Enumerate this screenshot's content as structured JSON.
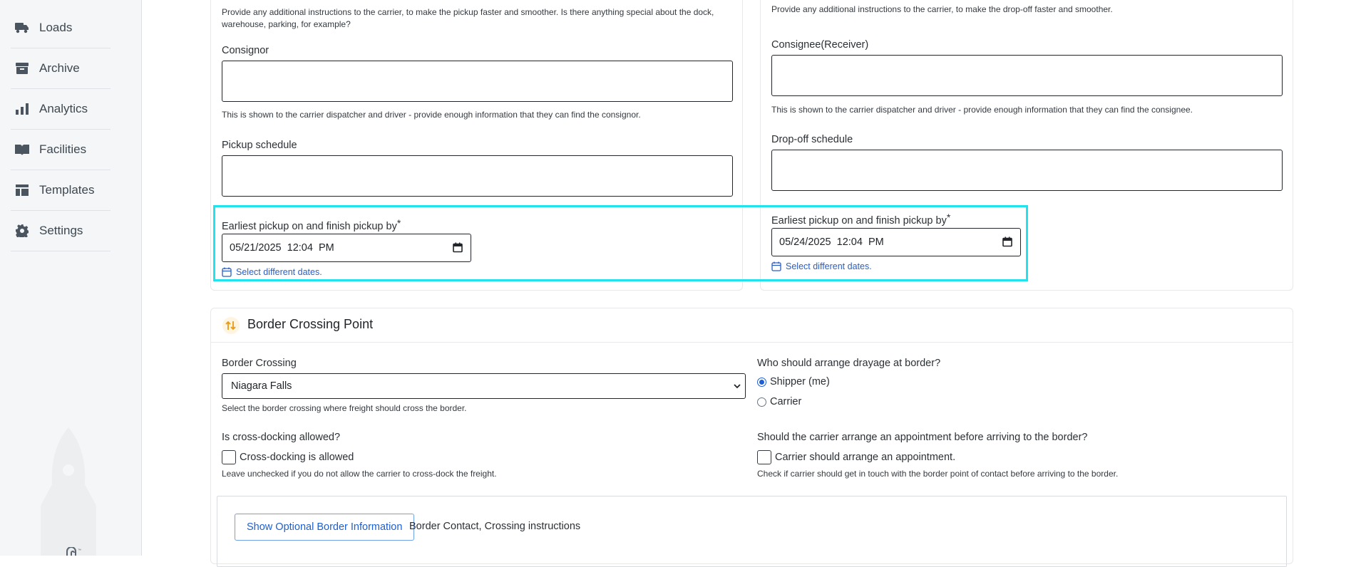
{
  "sidebar": {
    "items": [
      {
        "label": "Loads",
        "icon": "truck-icon"
      },
      {
        "label": "Archive",
        "icon": "archive-box-icon"
      },
      {
        "label": "Analytics",
        "icon": "bar-chart-icon"
      },
      {
        "label": "Facilities",
        "icon": "book-icon"
      },
      {
        "label": "Templates",
        "icon": "template-layout-icon"
      },
      {
        "label": "Settings",
        "icon": "gear-icon"
      }
    ]
  },
  "pickup": {
    "instructions_help": "Provide any additional instructions to the carrier, to make the pickup faster and smoother. Is there anything special about the dock, warehouse, parking, for example?",
    "consignor_label": "Consignor",
    "consignor_help": "This is shown to the carrier dispatcher and driver - provide enough information that they can find the consignor.",
    "schedule_label": "Pickup schedule",
    "window_label": "Earliest pickup on and finish pickup by",
    "required_mark": "*",
    "datetime_value": "05/21/2025  12:04  PM",
    "select_dates_link": "Select different dates."
  },
  "dropoff": {
    "instructions_help": "Provide any additional instructions to the carrier, to make the drop-off faster and smoother.",
    "consignee_label": "Consignee(Receiver)",
    "consignee_help": "This is shown to the carrier dispatcher and driver - provide enough information that they can find the consignee.",
    "schedule_label": "Drop-off schedule",
    "window_label": "Earliest pickup on and finish pickup by",
    "required_mark": "*",
    "datetime_value": "05/24/2025  12:04  PM",
    "select_dates_link": "Select different dates."
  },
  "border": {
    "title": "Border Crossing Point",
    "crossing_label": "Border Crossing",
    "crossing_value": "Niagara Falls",
    "crossing_help": "Select the border crossing where freight should cross the border.",
    "drayage_label": "Who should arrange drayage at border?",
    "drayage_options": [
      {
        "label": "Shipper (me)",
        "selected": true
      },
      {
        "label": "Carrier",
        "selected": false
      }
    ],
    "crossdock_label": "Is cross-docking allowed?",
    "crossdock_checkbox": "Cross-docking is allowed",
    "crossdock_checked": false,
    "crossdock_help": "Leave unchecked if you do not allow the carrier to cross-dock the freight.",
    "appointment_label": "Should the carrier arrange an appointment before arriving to the border?",
    "appointment_checkbox": "Carrier should arrange an appointment.",
    "appointment_checked": false,
    "appointment_help": "Check if carrier should get in touch with the border point of contact before arriving to the border.",
    "optional_button": "Show Optional Border Information",
    "optional_desc": "Border Contact, Crossing instructions"
  },
  "colors": {
    "accent": "#1f5fd1",
    "highlight": "#21e3ee",
    "sidebar_bg": "#f5f6f7"
  }
}
